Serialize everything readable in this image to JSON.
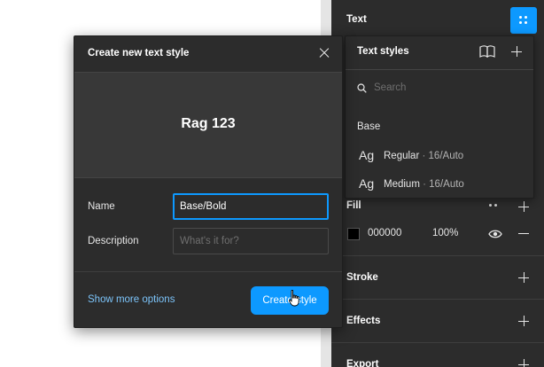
{
  "panel": {
    "title": "Text",
    "fill_label": "Fill",
    "fill_hex": "000000",
    "fill_opacity": "100%",
    "sections": [
      "Stroke",
      "Effects",
      "Export"
    ]
  },
  "styles_popover": {
    "title": "Text styles",
    "search_placeholder": "Search",
    "group": "Base",
    "items": [
      {
        "sample": "Ag",
        "name": "Regular",
        "sep": "·",
        "meta": "16/Auto"
      },
      {
        "sample": "Ag",
        "name": "Medium",
        "sep": "·",
        "meta": "16/Auto"
      }
    ]
  },
  "dialog": {
    "title": "Create new text style",
    "preview_text": "Rag 123",
    "name_label": "Name",
    "name_value": "Base/Bold",
    "description_label": "Description",
    "description_placeholder": "What's it for?",
    "more_options": "Show more options",
    "create_label": "Create style"
  },
  "colors": {
    "accent": "#0d99ff",
    "panel_bg": "#2c2c2c",
    "link": "#7cc4fa"
  }
}
